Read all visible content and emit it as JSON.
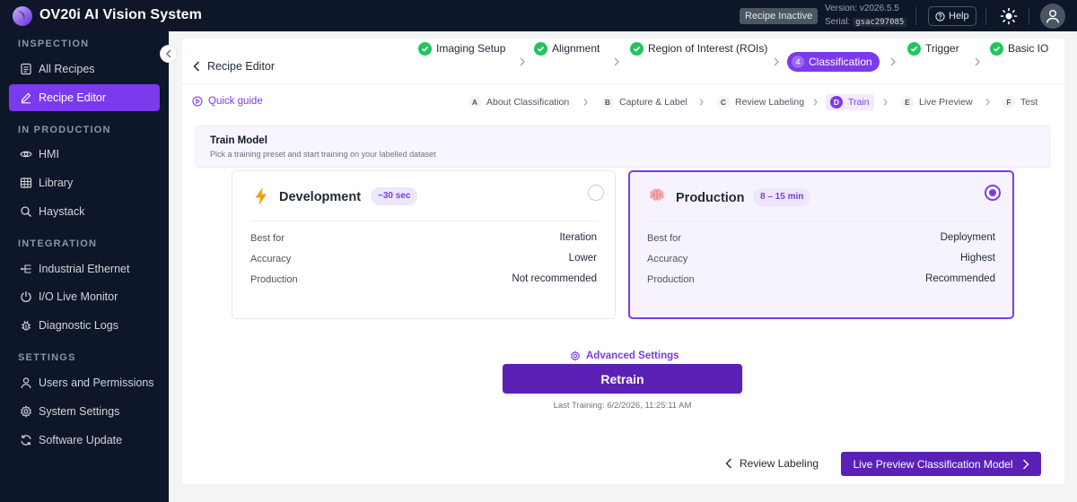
{
  "app": {
    "title": "OV20i AI Vision System",
    "status_badge": "Recipe Inactive",
    "version": "Version: v2026.5.5",
    "serial_label": "Serial:",
    "serial_code": "gsac297085",
    "help_label": "Help"
  },
  "colors": {
    "accent": "#7c3aed",
    "sidebar_bg": "#0e1729",
    "success": "#22c55e"
  },
  "sidebar": {
    "sections": [
      {
        "title": "INSPECTION"
      },
      {
        "title": "IN PRODUCTION"
      },
      {
        "title": "INTEGRATION"
      },
      {
        "title": "SETTINGS"
      }
    ],
    "items": [
      {
        "label": "All Recipes",
        "icon": "list-icon"
      },
      {
        "label": "Recipe Editor",
        "icon": "pencil-icon",
        "active": true
      },
      {
        "label": "HMI",
        "icon": "eye-icon"
      },
      {
        "label": "Library",
        "icon": "grid-icon"
      },
      {
        "label": "Haystack",
        "icon": "search-icon"
      },
      {
        "label": "Industrial Ethernet",
        "icon": "network-icon"
      },
      {
        "label": "I/O Live Monitor",
        "icon": "io-icon"
      },
      {
        "label": "Diagnostic Logs",
        "icon": "bug-icon"
      },
      {
        "label": "Users and Permissions",
        "icon": "user-icon"
      },
      {
        "label": "System Settings",
        "icon": "gear-icon"
      },
      {
        "label": "Software Update",
        "icon": "refresh-icon"
      }
    ]
  },
  "editor": {
    "back_label": "Recipe Editor",
    "steps": [
      {
        "label": "Imaging Setup",
        "done": true
      },
      {
        "label": "Alignment",
        "done": true
      },
      {
        "label": "Region of Interest (ROIs)",
        "done": true
      },
      {
        "label": "Classification",
        "number": "4",
        "current": true
      },
      {
        "label": "Trigger",
        "done": true
      },
      {
        "label": "Basic IO",
        "done": true
      }
    ]
  },
  "subnav": {
    "quick_guide": "Quick guide",
    "steps": [
      {
        "letter": "A",
        "label": "About Classification"
      },
      {
        "letter": "B",
        "label": "Capture & Label"
      },
      {
        "letter": "C",
        "label": "Review Labeling"
      },
      {
        "letter": "D",
        "label": "Train",
        "current": true
      },
      {
        "letter": "E",
        "label": "Live Preview"
      },
      {
        "letter": "F",
        "label": "Test"
      }
    ]
  },
  "train": {
    "title": "Train Model",
    "subtitle": "Pick a training preset and start training on your labelled dataset",
    "presets": [
      {
        "name": "Development",
        "icon": "lightning-icon",
        "time_badge": "~30 sec",
        "selected": false,
        "rows": [
          {
            "label": "Best for",
            "value": "Iteration"
          },
          {
            "label": "Accuracy",
            "value": "Lower"
          },
          {
            "label": "Production",
            "value": "Not recommended"
          }
        ]
      },
      {
        "name": "Production",
        "icon": "brain-icon",
        "time_badge": "8 – 15 min",
        "selected": true,
        "rows": [
          {
            "label": "Best for",
            "value": "Deployment"
          },
          {
            "label": "Accuracy",
            "value": "Highest"
          },
          {
            "label": "Production",
            "value": "Recommended"
          }
        ]
      }
    ],
    "advanced_label": "Advanced Settings",
    "retrain_label": "Retrain",
    "last_training": "Last Training: 6/2/2026, 11:25:11 AM"
  },
  "footer": {
    "back_label": "Review Labeling",
    "next_label": "Live Preview Classification Model"
  }
}
